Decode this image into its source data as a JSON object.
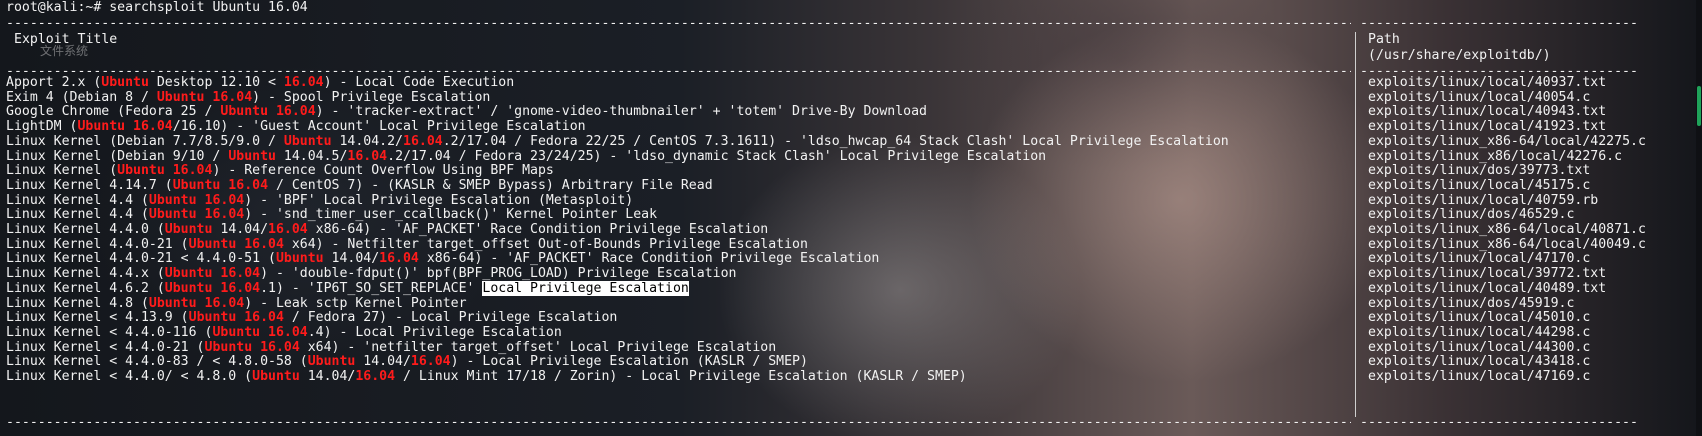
{
  "prompt": {
    "user": "root@kali",
    "sep": ":~# ",
    "command": "searchsploit Ubuntu 16.04"
  },
  "header": {
    "title": "Exploit Title",
    "path_label": "Path",
    "path_base": "(/usr/share/exploitdb/)"
  },
  "desktop_label": "文件系统",
  "dash_left": "----------------------------------------------------------------------------------------------------------------------------------------------------------------------------------",
  "dash_right": "-----------------------------------",
  "rows": [
    {
      "title": [
        [
          "Apport 2.x (",
          0
        ],
        [
          "Ubuntu",
          1
        ],
        [
          " Desktop 12.10 < ",
          0
        ],
        [
          "16.04",
          1
        ],
        [
          ") - Local Code Execution",
          0
        ]
      ],
      "path": "exploits/linux/local/40937.txt"
    },
    {
      "title": [
        [
          "Exim 4 (Debian 8 / ",
          0
        ],
        [
          "Ubuntu 16.04",
          1
        ],
        [
          ") - Spool Privilege Escalation",
          0
        ]
      ],
      "path": "exploits/linux/local/40054.c"
    },
    {
      "title": [
        [
          "Google Chrome (Fedora 25 / ",
          0
        ],
        [
          "Ubuntu 16.04",
          1
        ],
        [
          ") - 'tracker-extract' / 'gnome-video-thumbnailer' + 'totem' Drive-By Download",
          0
        ]
      ],
      "path": "exploits/linux/local/40943.txt"
    },
    {
      "title": [
        [
          "LightDM (",
          0
        ],
        [
          "Ubuntu 16.04",
          1
        ],
        [
          "/16.10) - 'Guest Account' Local Privilege Escalation",
          0
        ]
      ],
      "path": "exploits/linux/local/41923.txt"
    },
    {
      "title": [
        [
          "Linux Kernel (Debian 7.7/8.5/9.0 / ",
          0
        ],
        [
          "Ubuntu",
          1
        ],
        [
          " 14.04.2/",
          0
        ],
        [
          "16.04",
          1
        ],
        [
          ".2/17.04 / Fedora 22/25 / CentOS 7.3.1611) - 'ldso_hwcap_64 Stack Clash' Local Privilege Escalation",
          0
        ]
      ],
      "path": "exploits/linux_x86-64/local/42275.c"
    },
    {
      "title": [
        [
          "Linux Kernel (Debian 9/10 / ",
          0
        ],
        [
          "Ubuntu",
          1
        ],
        [
          " 14.04.5/",
          0
        ],
        [
          "16.04",
          1
        ],
        [
          ".2/17.04 / Fedora 23/24/25) - 'ldso_dynamic Stack Clash' Local Privilege Escalation",
          0
        ]
      ],
      "path": "exploits/linux_x86/local/42276.c"
    },
    {
      "title": [
        [
          "Linux Kernel (",
          0
        ],
        [
          "Ubuntu 16.04",
          1
        ],
        [
          ") - Reference Count Overflow Using BPF Maps",
          0
        ]
      ],
      "path": "exploits/linux/dos/39773.txt"
    },
    {
      "title": [
        [
          "Linux Kernel 4.14.7 (",
          0
        ],
        [
          "Ubuntu 16.04",
          1
        ],
        [
          " / CentOS 7) - (KASLR & SMEP Bypass) Arbitrary File Read",
          0
        ]
      ],
      "path": "exploits/linux/local/45175.c"
    },
    {
      "title": [
        [
          "Linux Kernel 4.4 (",
          0
        ],
        [
          "Ubuntu 16.04",
          1
        ],
        [
          ") - 'BPF' Local Privilege Escalation (Metasploit)",
          0
        ]
      ],
      "path": "exploits/linux/local/40759.rb"
    },
    {
      "title": [
        [
          "Linux Kernel 4.4 (",
          0
        ],
        [
          "Ubuntu 16.04",
          1
        ],
        [
          ") - 'snd_timer_user_ccallback()' Kernel Pointer Leak",
          0
        ]
      ],
      "path": "exploits/linux/dos/46529.c"
    },
    {
      "title": [
        [
          "Linux Kernel 4.4.0 (",
          0
        ],
        [
          "Ubuntu",
          1
        ],
        [
          " 14.04/",
          0
        ],
        [
          "16.04",
          1
        ],
        [
          " x86-64) - 'AF_PACKET' Race Condition Privilege Escalation",
          0
        ]
      ],
      "path": "exploits/linux_x86-64/local/40871.c"
    },
    {
      "title": [
        [
          "Linux Kernel 4.4.0-21 (",
          0
        ],
        [
          "Ubuntu 16.04",
          1
        ],
        [
          " x64) - Netfilter target_offset Out-of-Bounds Privilege Escalation",
          0
        ]
      ],
      "path": "exploits/linux_x86-64/local/40049.c"
    },
    {
      "title": [
        [
          "Linux Kernel 4.4.0-21 < 4.4.0-51 (",
          0
        ],
        [
          "Ubuntu",
          1
        ],
        [
          " 14.04/",
          0
        ],
        [
          "16.04",
          1
        ],
        [
          " x86-64) - 'AF_PACKET' Race Condition Privilege Escalation",
          0
        ]
      ],
      "path": "exploits/linux/local/47170.c"
    },
    {
      "title": [
        [
          "Linux Kernel 4.4.x (",
          0
        ],
        [
          "Ubuntu 16.04",
          1
        ],
        [
          ") - 'double-fdput()' bpf(BPF_PROG_LOAD) Privilege Escalation",
          0
        ]
      ],
      "path": "exploits/linux/local/39772.txt"
    },
    {
      "title": [
        [
          "Linux Kernel 4.6.2 (",
          0
        ],
        [
          "Ubuntu 16.04",
          1
        ],
        [
          ".1) - 'IP6T_SO_SET_REPLACE' ",
          0
        ],
        [
          "Local Privilege Escalation",
          2
        ]
      ],
      "path": "exploits/linux/local/40489.txt"
    },
    {
      "title": [
        [
          "Linux Kernel 4.8 (",
          0
        ],
        [
          "Ubuntu 16.04",
          1
        ],
        [
          ") - Leak sctp Kernel Pointer",
          0
        ]
      ],
      "path": "exploits/linux/dos/45919.c"
    },
    {
      "title": [
        [
          "Linux Kernel < 4.13.9 (",
          0
        ],
        [
          "Ubuntu 16.04",
          1
        ],
        [
          " / Fedora 27) - Local Privilege Escalation",
          0
        ]
      ],
      "path": "exploits/linux/local/45010.c"
    },
    {
      "title": [
        [
          "Linux Kernel < 4.4.0-116 (",
          0
        ],
        [
          "Ubuntu 16.04",
          1
        ],
        [
          ".4) - Local Privilege Escalation",
          0
        ]
      ],
      "path": "exploits/linux/local/44298.c"
    },
    {
      "title": [
        [
          "Linux Kernel < 4.4.0-21 (",
          0
        ],
        [
          "Ubuntu 16.04",
          1
        ],
        [
          " x64) - 'netfilter target_offset' Local Privilege Escalation",
          0
        ]
      ],
      "path": "exploits/linux/local/44300.c"
    },
    {
      "title": [
        [
          "Linux Kernel < 4.4.0-83 / < 4.8.0-58 (",
          0
        ],
        [
          "Ubuntu",
          1
        ],
        [
          " 14.04/",
          0
        ],
        [
          "16.04",
          1
        ],
        [
          ") - Local Privilege Escalation (KASLR / SMEP)",
          0
        ]
      ],
      "path": "exploits/linux/local/43418.c"
    },
    {
      "title": [
        [
          "Linux Kernel < 4.4.0/ < 4.8.0 (",
          0
        ],
        [
          "Ubuntu",
          1
        ],
        [
          " 14.04/",
          0
        ],
        [
          "16.04",
          1
        ],
        [
          " / Linux Mint 17/18 / Zorin) - Local Privilege Escalation (KASLR / SMEP)",
          0
        ]
      ],
      "path": "exploits/linux/local/47169.c"
    }
  ]
}
